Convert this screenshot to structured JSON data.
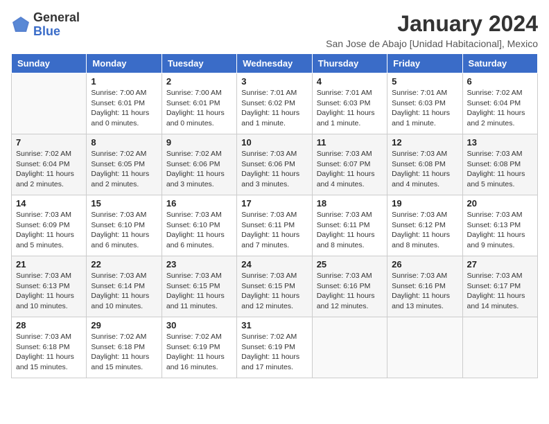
{
  "header": {
    "logo": {
      "general": "General",
      "blue": "Blue"
    },
    "title": "January 2024",
    "subtitle": "San Jose de Abajo [Unidad Habitacional], Mexico"
  },
  "calendar": {
    "days_of_week": [
      "Sunday",
      "Monday",
      "Tuesday",
      "Wednesday",
      "Thursday",
      "Friday",
      "Saturday"
    ],
    "weeks": [
      [
        {
          "date": "",
          "info": ""
        },
        {
          "date": "1",
          "info": "Sunrise: 7:00 AM\nSunset: 6:01 PM\nDaylight: 11 hours\nand 0 minutes."
        },
        {
          "date": "2",
          "info": "Sunrise: 7:00 AM\nSunset: 6:01 PM\nDaylight: 11 hours\nand 0 minutes."
        },
        {
          "date": "3",
          "info": "Sunrise: 7:01 AM\nSunset: 6:02 PM\nDaylight: 11 hours\nand 1 minute."
        },
        {
          "date": "4",
          "info": "Sunrise: 7:01 AM\nSunset: 6:03 PM\nDaylight: 11 hours\nand 1 minute."
        },
        {
          "date": "5",
          "info": "Sunrise: 7:01 AM\nSunset: 6:03 PM\nDaylight: 11 hours\nand 1 minute."
        },
        {
          "date": "6",
          "info": "Sunrise: 7:02 AM\nSunset: 6:04 PM\nDaylight: 11 hours\nand 2 minutes."
        }
      ],
      [
        {
          "date": "7",
          "info": "Sunrise: 7:02 AM\nSunset: 6:04 PM\nDaylight: 11 hours\nand 2 minutes."
        },
        {
          "date": "8",
          "info": "Sunrise: 7:02 AM\nSunset: 6:05 PM\nDaylight: 11 hours\nand 2 minutes."
        },
        {
          "date": "9",
          "info": "Sunrise: 7:02 AM\nSunset: 6:06 PM\nDaylight: 11 hours\nand 3 minutes."
        },
        {
          "date": "10",
          "info": "Sunrise: 7:03 AM\nSunset: 6:06 PM\nDaylight: 11 hours\nand 3 minutes."
        },
        {
          "date": "11",
          "info": "Sunrise: 7:03 AM\nSunset: 6:07 PM\nDaylight: 11 hours\nand 4 minutes."
        },
        {
          "date": "12",
          "info": "Sunrise: 7:03 AM\nSunset: 6:08 PM\nDaylight: 11 hours\nand 4 minutes."
        },
        {
          "date": "13",
          "info": "Sunrise: 7:03 AM\nSunset: 6:08 PM\nDaylight: 11 hours\nand 5 minutes."
        }
      ],
      [
        {
          "date": "14",
          "info": "Sunrise: 7:03 AM\nSunset: 6:09 PM\nDaylight: 11 hours\nand 5 minutes."
        },
        {
          "date": "15",
          "info": "Sunrise: 7:03 AM\nSunset: 6:10 PM\nDaylight: 11 hours\nand 6 minutes."
        },
        {
          "date": "16",
          "info": "Sunrise: 7:03 AM\nSunset: 6:10 PM\nDaylight: 11 hours\nand 6 minutes."
        },
        {
          "date": "17",
          "info": "Sunrise: 7:03 AM\nSunset: 6:11 PM\nDaylight: 11 hours\nand 7 minutes."
        },
        {
          "date": "18",
          "info": "Sunrise: 7:03 AM\nSunset: 6:11 PM\nDaylight: 11 hours\nand 8 minutes."
        },
        {
          "date": "19",
          "info": "Sunrise: 7:03 AM\nSunset: 6:12 PM\nDaylight: 11 hours\nand 8 minutes."
        },
        {
          "date": "20",
          "info": "Sunrise: 7:03 AM\nSunset: 6:13 PM\nDaylight: 11 hours\nand 9 minutes."
        }
      ],
      [
        {
          "date": "21",
          "info": "Sunrise: 7:03 AM\nSunset: 6:13 PM\nDaylight: 11 hours\nand 10 minutes."
        },
        {
          "date": "22",
          "info": "Sunrise: 7:03 AM\nSunset: 6:14 PM\nDaylight: 11 hours\nand 10 minutes."
        },
        {
          "date": "23",
          "info": "Sunrise: 7:03 AM\nSunset: 6:15 PM\nDaylight: 11 hours\nand 11 minutes."
        },
        {
          "date": "24",
          "info": "Sunrise: 7:03 AM\nSunset: 6:15 PM\nDaylight: 11 hours\nand 12 minutes."
        },
        {
          "date": "25",
          "info": "Sunrise: 7:03 AM\nSunset: 6:16 PM\nDaylight: 11 hours\nand 12 minutes."
        },
        {
          "date": "26",
          "info": "Sunrise: 7:03 AM\nSunset: 6:16 PM\nDaylight: 11 hours\nand 13 minutes."
        },
        {
          "date": "27",
          "info": "Sunrise: 7:03 AM\nSunset: 6:17 PM\nDaylight: 11 hours\nand 14 minutes."
        }
      ],
      [
        {
          "date": "28",
          "info": "Sunrise: 7:03 AM\nSunset: 6:18 PM\nDaylight: 11 hours\nand 15 minutes."
        },
        {
          "date": "29",
          "info": "Sunrise: 7:02 AM\nSunset: 6:18 PM\nDaylight: 11 hours\nand 15 minutes."
        },
        {
          "date": "30",
          "info": "Sunrise: 7:02 AM\nSunset: 6:19 PM\nDaylight: 11 hours\nand 16 minutes."
        },
        {
          "date": "31",
          "info": "Sunrise: 7:02 AM\nSunset: 6:19 PM\nDaylight: 11 hours\nand 17 minutes."
        },
        {
          "date": "",
          "info": ""
        },
        {
          "date": "",
          "info": ""
        },
        {
          "date": "",
          "info": ""
        }
      ]
    ]
  }
}
